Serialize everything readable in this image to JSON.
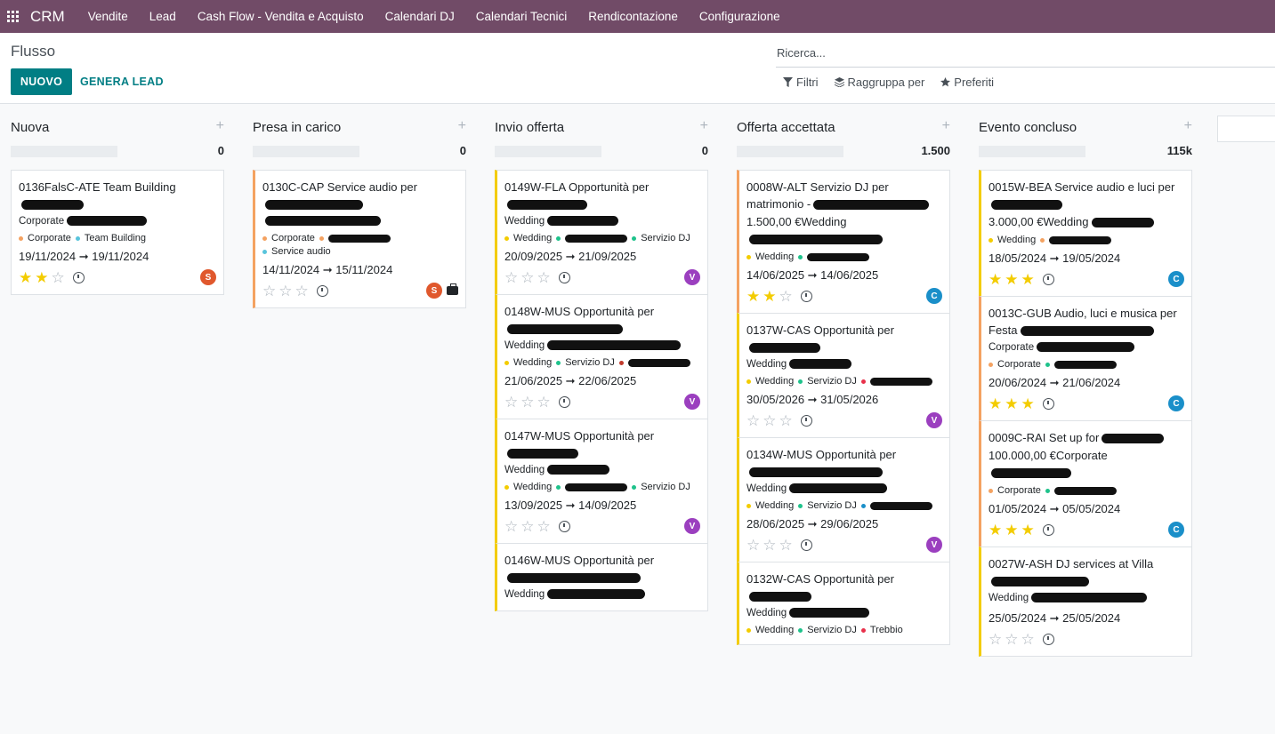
{
  "app": {
    "name": "CRM"
  },
  "nav": [
    "Vendite",
    "Lead",
    "Cash Flow - Vendita e Acquisto",
    "Calendari DJ",
    "Calendari Tecnici",
    "Rendicontazione",
    "Configurazione"
  ],
  "page": {
    "title": "Flusso",
    "new_label": "NUOVO",
    "generate_label": "GENERA LEAD"
  },
  "search": {
    "placeholder": "Ricerca...",
    "filters_label": "Filtri",
    "group_label": "Raggruppa per",
    "favorites_label": "Preferiti"
  },
  "colors": {
    "brand": "#714B67",
    "accent": "#017E84",
    "star": "#f3cc00"
  },
  "columns": [
    {
      "title": "Nuova",
      "total": "0",
      "cards": [
        {
          "color": "",
          "title": "0136FalsC-ATE Team Building",
          "line1": "Corporate",
          "tags": [
            {
              "name": "Corporate",
              "color": "#f4a261"
            },
            {
              "name": "Team Building",
              "color": "#58c4dc"
            }
          ],
          "dates": "19/11/2024 ➞ 19/11/2024",
          "stars": 2,
          "avatar": "S",
          "avatar_color": "#e0582d"
        }
      ]
    },
    {
      "title": "Presa in carico",
      "total": "0",
      "cards": [
        {
          "color": "#f4a261",
          "title": "0130C-CAP Service audio per",
          "line1": "",
          "tags": [
            {
              "name": "Corporate",
              "color": "#f4a261"
            },
            {
              "name": "",
              "color": "#f4a261"
            },
            {
              "name": "Service audio",
              "color": "#58c4dc"
            }
          ],
          "dates": "14/11/2024 ➞ 15/11/2024",
          "stars": 0,
          "avatar": "S",
          "avatar_color": "#e0582d"
        }
      ]
    },
    {
      "title": "Invio offerta",
      "total": "0",
      "cards": [
        {
          "color": "#f3cc00",
          "title": "0149W-FLA Opportunità per",
          "line1": "Wedding",
          "tags": [
            {
              "name": "Wedding",
              "color": "#f3cc00"
            },
            {
              "name": "",
              "color": "#1ec28b"
            },
            {
              "name": "Servizio DJ",
              "color": "#1ec28b"
            }
          ],
          "dates": "20/09/2025 ➞ 21/09/2025",
          "stars": 0,
          "avatar": "V",
          "avatar_color": "#9b3fbf"
        },
        {
          "color": "#f3cc00",
          "title": "0148W-MUS Opportunità per",
          "line1": "Wedding",
          "tags": [
            {
              "name": "Wedding",
              "color": "#f3cc00"
            },
            {
              "name": "Servizio DJ",
              "color": "#1ec28b"
            },
            {
              "name": "",
              "color": "#c0392b"
            }
          ],
          "dates": "21/06/2025 ➞ 22/06/2025",
          "stars": 0,
          "avatar": "V",
          "avatar_color": "#9b3fbf"
        },
        {
          "color": "#f3cc00",
          "title": "0147W-MUS Opportunità per",
          "line1": "Wedding",
          "tags": [
            {
              "name": "Wedding",
              "color": "#f3cc00"
            },
            {
              "name": "",
              "color": "#1ec28b"
            },
            {
              "name": "Servizio DJ",
              "color": "#1ec28b"
            }
          ],
          "dates": "13/09/2025 ➞ 14/09/2025",
          "stars": 0,
          "avatar": "V",
          "avatar_color": "#9b3fbf"
        },
        {
          "color": "#f3cc00",
          "title": "0146W-MUS Opportunità per",
          "line1": "Wedding",
          "tags": [],
          "dates": "",
          "stars": 0,
          "avatar": "",
          "avatar_color": ""
        }
      ]
    },
    {
      "title": "Offerta accettata",
      "total": "1.500",
      "cards": [
        {
          "color": "#f4a261",
          "title": "0008W-ALT Servizio DJ per matrimonio -",
          "line1": "1.500,00 €Wedding",
          "tags": [
            {
              "name": "Wedding",
              "color": "#f3cc00"
            },
            {
              "name": "",
              "color": "#1ec28b"
            }
          ],
          "dates": "14/06/2025 ➞ 14/06/2025",
          "stars": 2,
          "avatar": "C",
          "avatar_color": "#1a8fc9"
        },
        {
          "color": "#f3cc00",
          "title": "0137W-CAS Opportunità per",
          "line1": "Wedding",
          "tags": [
            {
              "name": "Wedding",
              "color": "#f3cc00"
            },
            {
              "name": "Servizio DJ",
              "color": "#1ec28b"
            },
            {
              "name": "",
              "color": "#e8304a"
            }
          ],
          "dates": "30/05/2026 ➞ 31/05/2026",
          "stars": 0,
          "avatar": "V",
          "avatar_color": "#9b3fbf"
        },
        {
          "color": "#f3cc00",
          "title": "0134W-MUS Opportunità per",
          "line1": "Wedding",
          "tags": [
            {
              "name": "Wedding",
              "color": "#f3cc00"
            },
            {
              "name": "Servizio DJ",
              "color": "#1ec28b"
            },
            {
              "name": "",
              "color": "#1a8fc9"
            }
          ],
          "dates": "28/06/2025 ➞ 29/06/2025",
          "stars": 0,
          "avatar": "V",
          "avatar_color": "#9b3fbf"
        },
        {
          "color": "#f3cc00",
          "title": "0132W-CAS Opportunità per",
          "line1": "Wedding",
          "tags": [
            {
              "name": "Wedding",
              "color": "#f3cc00"
            },
            {
              "name": "Servizio DJ",
              "color": "#1ec28b"
            },
            {
              "name": "Trebbio",
              "color": "#e8304a"
            }
          ],
          "dates": "",
          "stars": 0,
          "avatar": "",
          "avatar_color": ""
        }
      ]
    },
    {
      "title": "Evento concluso",
      "total": "115k",
      "cards": [
        {
          "color": "#f3cc00",
          "title": "0015W-BEA Service audio e luci per",
          "line1": "3.000,00 €Wedding",
          "tags": [
            {
              "name": "Wedding",
              "color": "#f3cc00"
            },
            {
              "name": "",
              "color": "#f4a261"
            }
          ],
          "dates": "18/05/2024 ➞ 19/05/2024",
          "stars": 3,
          "avatar": "C",
          "avatar_color": "#1a8fc9"
        },
        {
          "color": "#f4a261",
          "title": "0013C-GUB Audio, luci e musica per Festa",
          "line1": "Corporate",
          "tags": [
            {
              "name": "Corporate",
              "color": "#f4a261"
            },
            {
              "name": "",
              "color": "#1ec28b"
            }
          ],
          "dates": "20/06/2024 ➞ 21/06/2024",
          "stars": 3,
          "avatar": "C",
          "avatar_color": "#1a8fc9"
        },
        {
          "color": "#f4a261",
          "title": "0009C-RAI Set up for",
          "line1": "100.000,00 €Corporate",
          "tags": [
            {
              "name": "Corporate",
              "color": "#f4a261"
            },
            {
              "name": "",
              "color": "#1ec28b"
            }
          ],
          "dates": "01/05/2024 ➞ 05/05/2024",
          "stars": 3,
          "avatar": "C",
          "avatar_color": "#1a8fc9"
        },
        {
          "color": "#f3cc00",
          "title": "0027W-ASH DJ services at Villa",
          "line1": "Wedding",
          "tags": [],
          "dates": "25/05/2024 ➞ 25/05/2024",
          "stars": 0,
          "avatar": "",
          "avatar_color": ""
        }
      ]
    }
  ]
}
